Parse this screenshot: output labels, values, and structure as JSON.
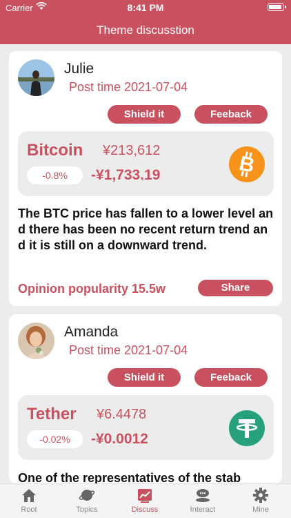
{
  "status_bar": {
    "carrier": "Carrier",
    "time": "8:41 PM"
  },
  "header": {
    "title": "Theme discusstion"
  },
  "posts": [
    {
      "username": "Julie",
      "post_time": "Post time 2021-07-04",
      "shield_label": "Shield it",
      "feedback_label": "Feeback",
      "coin": {
        "name": "Bitcoin",
        "price": "¥213,612",
        "change_pct": "-0.8%",
        "change_value": "-¥1,733.19",
        "icon": "bitcoin-icon",
        "color": "#f7931a"
      },
      "text": "The BTC price has fallen to a lower level and there has been no recent return trend and it is still on a downward trend.",
      "popularity": "Opinion popularity 15.5w",
      "share_label": "Share"
    },
    {
      "username": "Amanda",
      "post_time": "Post time 2021-07-04",
      "shield_label": "Shield it",
      "feedback_label": "Feeback",
      "coin": {
        "name": "Tether",
        "price": "¥6.4478",
        "change_pct": "-0.02%",
        "change_value": "-¥0.0012",
        "icon": "tether-icon",
        "color": "#26a17b"
      },
      "text": "One of the representatives of the stab"
    }
  ],
  "tabbar": {
    "items": [
      {
        "label": "Root",
        "icon": "home-icon"
      },
      {
        "label": "Topics",
        "icon": "planet-icon"
      },
      {
        "label": "Discuss",
        "icon": "chart-icon",
        "active": true
      },
      {
        "label": "Interact",
        "icon": "chat-icon"
      },
      {
        "label": "Mine",
        "icon": "gear-icon"
      }
    ]
  },
  "colors": {
    "accent": "#c9515f",
    "background": "#ececec"
  }
}
